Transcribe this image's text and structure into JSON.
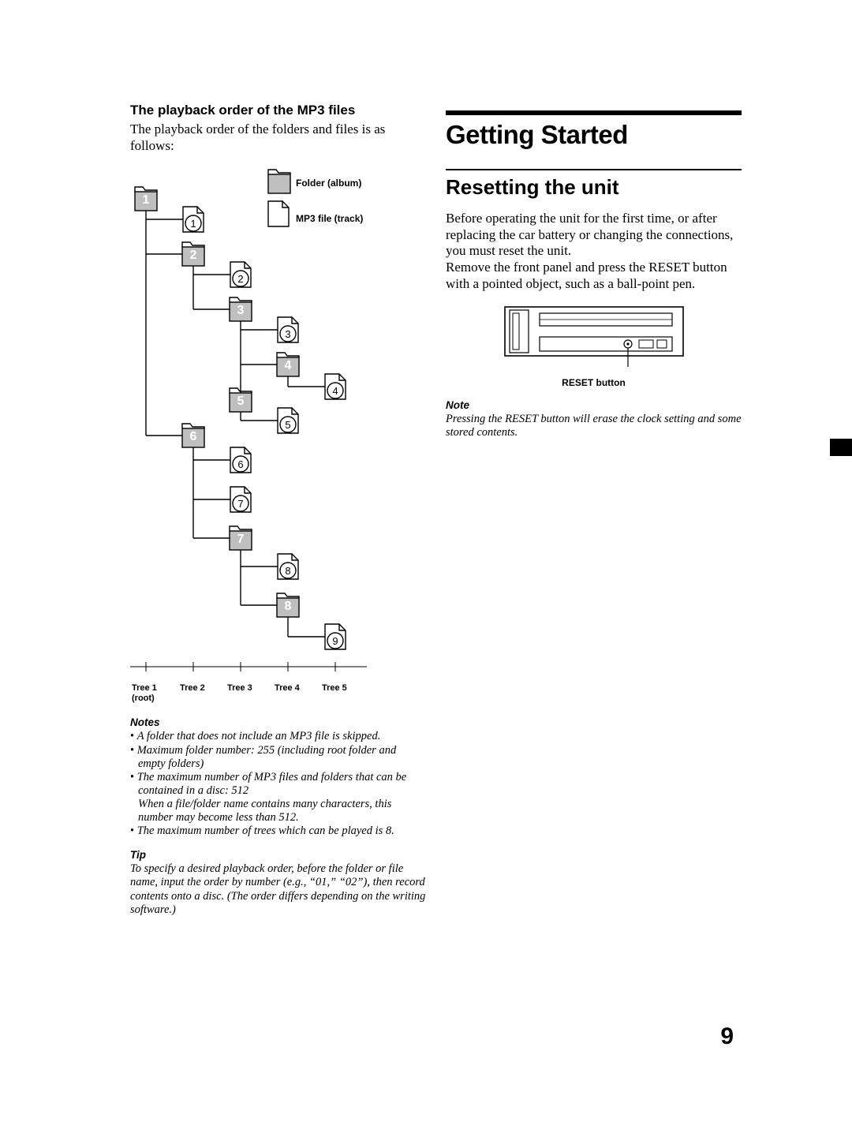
{
  "left": {
    "subhead": "The playback order of the MP3 files",
    "intro": "The playback order of the folders and files is as follows:",
    "legend_folder": "Folder (album)",
    "legend_file": "MP3 file (track)",
    "tree_labels": [
      "Tree 1\n(root)",
      "Tree 2",
      "Tree 3",
      "Tree 4",
      "Tree 5"
    ],
    "notes_head": "Notes",
    "notes": [
      "A folder that does not include an MP3 file is skipped.",
      "Maximum folder number: 255 (including root folder and empty folders)",
      "The maximum number of MP3 files and folders that can be contained in a disc: 512\nWhen a file/folder name contains many characters, this number may become less than 512.",
      "The maximum number of trees which can be played is 8."
    ],
    "tip_head": "Tip",
    "tip": "To specify a desired playback order, before the folder or file name, input the order by number (e.g., “01,” “02”), then record contents onto a disc. (The order differs depending on the writing software.)"
  },
  "right": {
    "section": "Getting Started",
    "subsection": "Resetting the unit",
    "body1": "Before operating the unit for the first time, or after replacing the car battery or changing the connections, you must reset the unit.",
    "body2": "Remove the front panel and press the RESET button with a pointed object, such as a ball-point pen.",
    "caption": "RESET button",
    "note_head": "Note",
    "note": "Pressing the RESET button will erase the clock setting and some stored contents."
  },
  "page_number": "9",
  "chart_data": {
    "type": "tree-diagram",
    "title": "MP3 playback order tree",
    "legend": {
      "folder": "Folder (album)",
      "file": "MP3 file (track)"
    },
    "max_trees": 8,
    "tree_columns": [
      "Tree 1 (root)",
      "Tree 2",
      "Tree 3",
      "Tree 4",
      "Tree 5"
    ],
    "playback_order": [
      {
        "type": "folder",
        "label": "1",
        "depth": 1
      },
      {
        "type": "file",
        "label": "1",
        "depth": 2,
        "parent_folder": "1"
      },
      {
        "type": "folder",
        "label": "2",
        "depth": 2,
        "parent_folder": "1"
      },
      {
        "type": "file",
        "label": "2",
        "depth": 3,
        "parent_folder": "2"
      },
      {
        "type": "folder",
        "label": "3",
        "depth": 3,
        "parent_folder": "2"
      },
      {
        "type": "file",
        "label": "3",
        "depth": 4,
        "parent_folder": "3"
      },
      {
        "type": "folder",
        "label": "4",
        "depth": 4,
        "parent_folder": "3"
      },
      {
        "type": "folder",
        "label": "5",
        "depth": 4,
        "parent_folder": "3"
      },
      {
        "type": "file",
        "label": "4",
        "depth": 5,
        "parent_folder": "4"
      },
      {
        "type": "file",
        "label": "5",
        "depth": 5,
        "parent_folder": "5"
      },
      {
        "type": "folder",
        "label": "6",
        "depth": 2,
        "parent_folder": "1"
      },
      {
        "type": "file",
        "label": "6",
        "depth": 3,
        "parent_folder": "6"
      },
      {
        "type": "file",
        "label": "7",
        "depth": 3,
        "parent_folder": "6"
      },
      {
        "type": "folder",
        "label": "7",
        "depth": 3,
        "parent_folder": "6"
      },
      {
        "type": "file",
        "label": "8",
        "depth": 4,
        "parent_folder": "7"
      },
      {
        "type": "folder",
        "label": "8",
        "depth": 4,
        "parent_folder": "7"
      },
      {
        "type": "file",
        "label": "9",
        "depth": 5,
        "parent_folder": "8"
      }
    ]
  }
}
